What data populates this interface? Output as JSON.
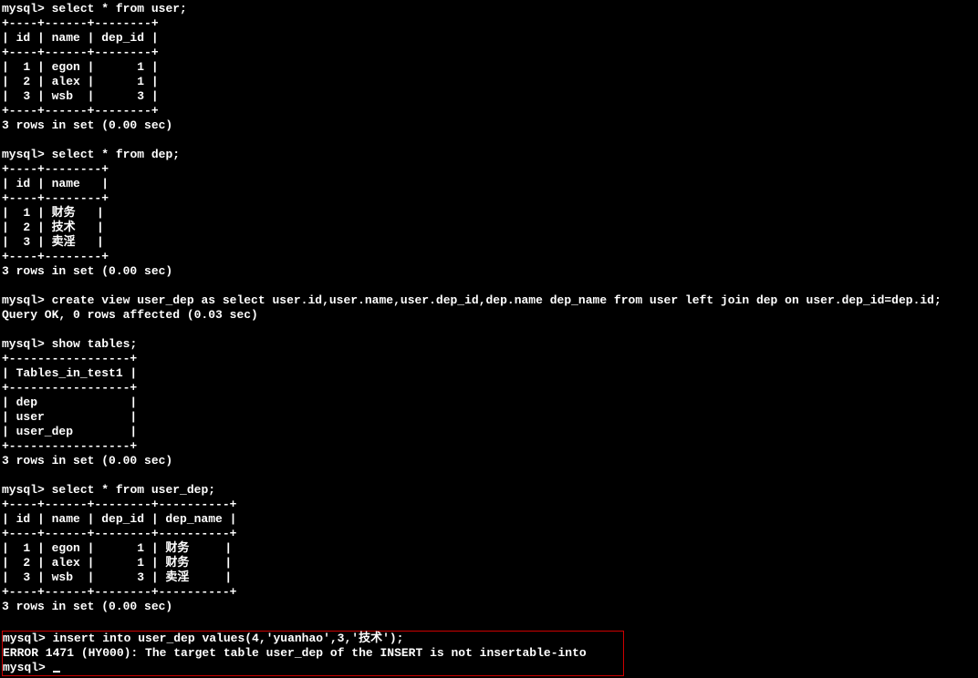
{
  "prompt": "mysql>",
  "queries": {
    "q1": "select * from user;",
    "q2": "select * from dep;",
    "q3": "create view user_dep as select user.id,user.name,user.dep_id,dep.name dep_name from user left join dep on user.dep_id=dep.id;",
    "q4": "show tables;",
    "q5": "select * from user_dep;",
    "q6": "insert into user_dep values(4,'yuanhao',3,'技术');"
  },
  "tables": {
    "user": {
      "header_sep": "+----+------+--------+",
      "header": "| id | name | dep_id |",
      "rows": [
        "|  1 | egon |      1 |",
        "|  2 | alex |      1 |",
        "|  3 | wsb  |      3 |"
      ]
    },
    "dep": {
      "header_sep": "+----+--------+",
      "header": "| id | name   |",
      "rows": [
        "|  1 | 财务   |",
        "|  2 | 技术   |",
        "|  3 | 卖淫   |"
      ]
    },
    "show_tables": {
      "header_sep": "+-----------------+",
      "header": "| Tables_in_test1 |",
      "rows": [
        "| dep             |",
        "| user            |",
        "| user_dep        |"
      ]
    },
    "user_dep": {
      "header_sep": "+----+------+--------+----------+",
      "header": "| id | name | dep_id | dep_name |",
      "rows": [
        "|  1 | egon |      1 | 财务     |",
        "|  2 | alex |      1 | 财务     |",
        "|  3 | wsb  |      3 | 卖淫     |"
      ]
    }
  },
  "messages": {
    "rows3": "3 rows in set (0.00 sec)",
    "query_ok": "Query OK, 0 rows affected (0.03 sec)",
    "error": "ERROR 1471 (HY000): The target table user_dep of the INSERT is not insertable-into"
  },
  "blank": " "
}
